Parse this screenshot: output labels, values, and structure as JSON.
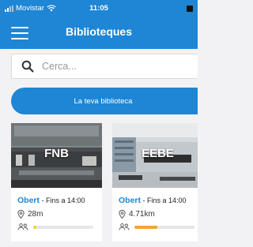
{
  "status_bar": {
    "carrier": "Movistar",
    "time": "11:05"
  },
  "nav": {
    "title": "Biblioteques",
    "menu_icon": "hamburger-menu-icon"
  },
  "search": {
    "placeholder": "Cerca...",
    "value": "",
    "icon": "search-icon"
  },
  "cta": {
    "label": "La teva biblioteca"
  },
  "libraries": [
    {
      "name": "FNB",
      "status": "Obert",
      "hours": " - Fins a 14:00",
      "distance": "28m",
      "occupancy": 0.05,
      "occupancy_color": "#e6d52a"
    },
    {
      "name": "EEBE",
      "status": "Obert",
      "hours": " - Fins a 14:00",
      "distance": "4.71km",
      "occupancy": 0.38,
      "occupancy_color": "#f4a23a"
    }
  ],
  "colors": {
    "primary": "#1e86d4",
    "background": "#f2f2f4"
  }
}
